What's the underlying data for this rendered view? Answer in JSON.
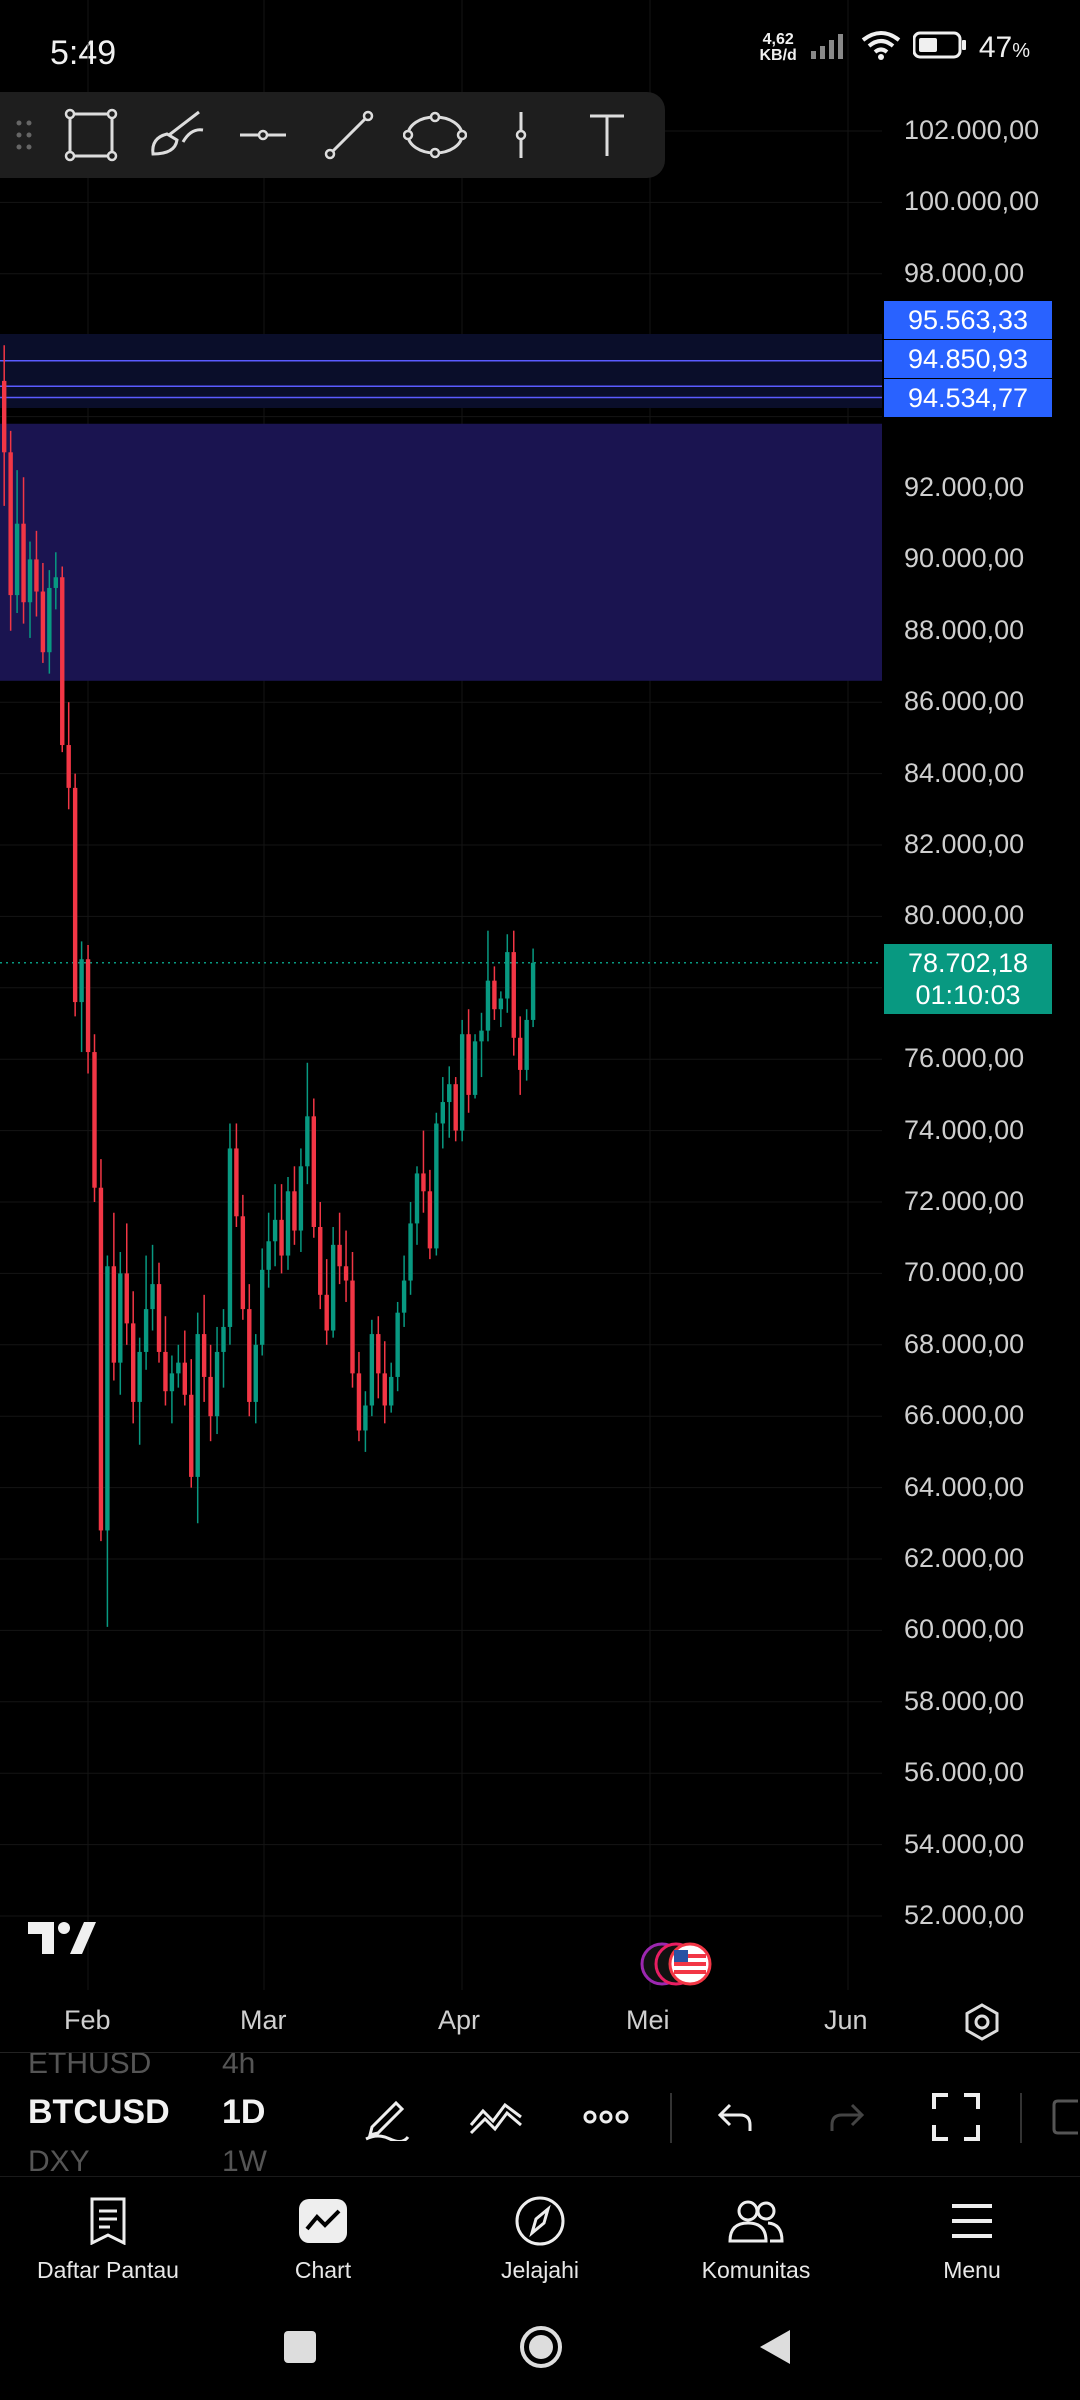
{
  "status_bar": {
    "time": "5:49",
    "net_speed_value": "4,62",
    "net_speed_unit": "KB/d",
    "battery_percent": "47",
    "battery_unit": "%"
  },
  "drawing_toolbar": {
    "tools": [
      "rectangle-icon",
      "brush-icon",
      "horizontal-line-icon",
      "trend-line-icon",
      "ellipse-icon",
      "vertical-line-icon",
      "text-icon"
    ]
  },
  "chart_data": {
    "type": "candlestick",
    "price_axis_labels": [
      "102.000,00",
      "100.000,00",
      "98.000,00",
      "92.000,00",
      "90.000,00",
      "88.000,00",
      "86.000,00",
      "84.000,00",
      "82.000,00",
      "80.000,00",
      "76.000,00",
      "74.000,00",
      "72.000,00",
      "70.000,00",
      "68.000,00",
      "66.000,00",
      "64.000,00",
      "62.000,00",
      "60.000,00",
      "58.000,00",
      "56.000,00",
      "54.000,00",
      "52.000,00"
    ],
    "price_tags": [
      "95.563,33",
      "94.850,93",
      "94.534,77"
    ],
    "current_price": "78.702,18",
    "countdown": "01:10:03",
    "time_axis_labels": [
      "Feb",
      "Mar",
      "Apr",
      "Mei",
      "Jun"
    ],
    "ylim": [
      51000,
      103500
    ],
    "zone": {
      "from": 86600,
      "to": 93800
    },
    "horizontal_lines": [
      95563.33,
      94850.93,
      94534.77
    ],
    "candles": [
      [
        95000,
        96000,
        91500,
        93000
      ],
      [
        93000,
        93600,
        88000,
        89000
      ],
      [
        89000,
        92500,
        88500,
        91000
      ],
      [
        91000,
        92300,
        88200,
        88800
      ],
      [
        88800,
        90500,
        87800,
        90000
      ],
      [
        90000,
        90800,
        88400,
        89100
      ],
      [
        89100,
        89900,
        87100,
        87400
      ],
      [
        87400,
        89700,
        86800,
        89200
      ],
      [
        89200,
        90200,
        88600,
        89500
      ],
      [
        89500,
        89800,
        84600,
        84800
      ],
      [
        84800,
        86000,
        83000,
        83600
      ],
      [
        83600,
        84000,
        77200,
        77600
      ],
      [
        77600,
        79300,
        76200,
        78800
      ],
      [
        78800,
        79200,
        75600,
        76200
      ],
      [
        76200,
        76700,
        72000,
        72400
      ],
      [
        72400,
        73200,
        62500,
        62800
      ],
      [
        62800,
        70500,
        60100,
        70200
      ],
      [
        70200,
        71700,
        67000,
        67500
      ],
      [
        67500,
        70600,
        66600,
        70000
      ],
      [
        70000,
        71400,
        68000,
        68600
      ],
      [
        68600,
        69500,
        65800,
        66400
      ],
      [
        66400,
        68200,
        65200,
        67800
      ],
      [
        67800,
        70500,
        67300,
        69000
      ],
      [
        69000,
        70800,
        68400,
        69700
      ],
      [
        69700,
        70300,
        67500,
        67800
      ],
      [
        67800,
        68800,
        66300,
        66700
      ],
      [
        66700,
        67700,
        65800,
        67200
      ],
      [
        67200,
        68000,
        66800,
        67500
      ],
      [
        67500,
        68400,
        66300,
        66600
      ],
      [
        66600,
        67600,
        64000,
        64300
      ],
      [
        64300,
        68900,
        63000,
        68300
      ],
      [
        68300,
        69400,
        66400,
        67100
      ],
      [
        67100,
        68000,
        65300,
        66000
      ],
      [
        66000,
        68500,
        65500,
        67800
      ],
      [
        67800,
        69000,
        66800,
        68500
      ],
      [
        68500,
        74200,
        68000,
        73500
      ],
      [
        73500,
        74200,
        71300,
        71600
      ],
      [
        71600,
        72200,
        68700,
        69000
      ],
      [
        69000,
        69700,
        66000,
        66400
      ],
      [
        66400,
        68300,
        65800,
        68000
      ],
      [
        68000,
        70700,
        67700,
        70100
      ],
      [
        70100,
        71700,
        69600,
        70900
      ],
      [
        70900,
        72500,
        70200,
        71500
      ],
      [
        71500,
        72500,
        70000,
        70500
      ],
      [
        70500,
        72700,
        70100,
        72300
      ],
      [
        72300,
        73000,
        70800,
        71200
      ],
      [
        71200,
        73500,
        70600,
        73000
      ],
      [
        73000,
        75900,
        72500,
        74400
      ],
      [
        74400,
        74900,
        71000,
        71300
      ],
      [
        71300,
        72000,
        69000,
        69400
      ],
      [
        69400,
        70400,
        68000,
        68400
      ],
      [
        68400,
        71300,
        68200,
        70800
      ],
      [
        70800,
        71700,
        69700,
        70200
      ],
      [
        70200,
        71200,
        69200,
        69800
      ],
      [
        69800,
        70600,
        66800,
        67200
      ],
      [
        67200,
        67800,
        65300,
        65600
      ],
      [
        65600,
        66700,
        65000,
        66300
      ],
      [
        66300,
        68700,
        66000,
        68300
      ],
      [
        68300,
        68800,
        66500,
        67200
      ],
      [
        67200,
        68100,
        65800,
        66300
      ],
      [
        66300,
        67500,
        66100,
        67100
      ],
      [
        67100,
        69200,
        66700,
        68900
      ],
      [
        68900,
        70500,
        68500,
        69800
      ],
      [
        69800,
        72000,
        69400,
        71400
      ],
      [
        71400,
        73000,
        70800,
        72800
      ],
      [
        72800,
        74000,
        71700,
        72300
      ],
      [
        72300,
        72900,
        70400,
        70700
      ],
      [
        70700,
        74500,
        70500,
        74200
      ],
      [
        74200,
        75500,
        73500,
        74800
      ],
      [
        74800,
        75800,
        73800,
        75300
      ],
      [
        75300,
        75500,
        73700,
        74000
      ],
      [
        74000,
        77100,
        73700,
        76700
      ],
      [
        76700,
        77400,
        74500,
        75000
      ],
      [
        75000,
        76700,
        74900,
        76500
      ],
      [
        76500,
        77300,
        75500,
        76800
      ],
      [
        76800,
        79600,
        76500,
        78200
      ],
      [
        78200,
        78600,
        77100,
        77400
      ],
      [
        77400,
        77900,
        76900,
        77700
      ],
      [
        77700,
        79500,
        77300,
        79000
      ],
      [
        79000,
        79600,
        76100,
        76600
      ],
      [
        76600,
        77200,
        75000,
        75700
      ],
      [
        75700,
        77400,
        75400,
        77100
      ],
      [
        77100,
        79100,
        76900,
        78700
      ]
    ]
  },
  "symbol_bar": {
    "prev_symbol": "ETHUSD",
    "prev_timeframe": "4h",
    "symbol": "BTCUSD",
    "timeframe": "1D",
    "next_symbol": "DXY",
    "next_timeframe": "1W"
  },
  "bottom_nav": {
    "watchlist": "Daftar Pantau",
    "chart": "Chart",
    "explore": "Jelajahi",
    "community": "Komunitas",
    "menu": "Menu"
  },
  "colors": {
    "up": "#089981",
    "down": "#f23645",
    "zone": "#1a1450",
    "tag": "#2962ff"
  }
}
